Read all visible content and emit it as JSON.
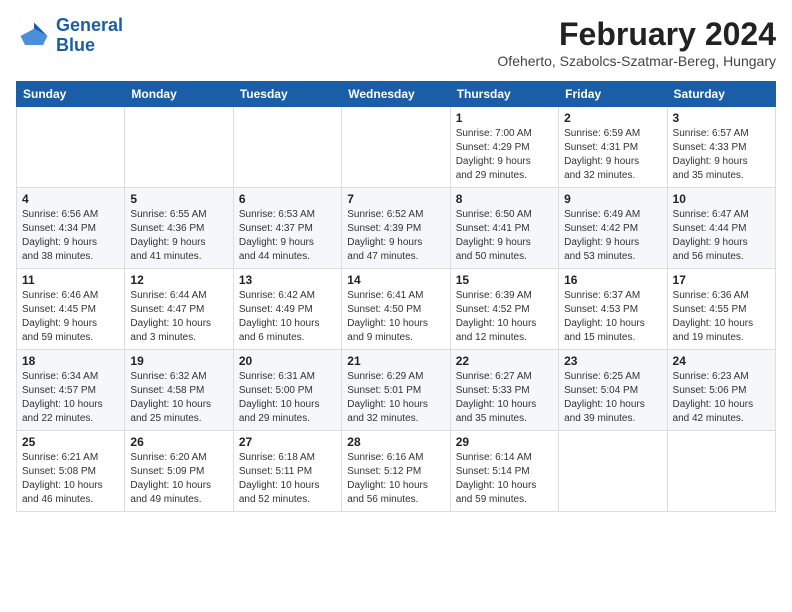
{
  "header": {
    "logo_line1": "General",
    "logo_line2": "Blue",
    "month_year": "February 2024",
    "location": "Ofeherto, Szabolcs-Szatmar-Bereg, Hungary"
  },
  "weekdays": [
    "Sunday",
    "Monday",
    "Tuesday",
    "Wednesday",
    "Thursday",
    "Friday",
    "Saturday"
  ],
  "weeks": [
    [
      {
        "day": "",
        "info": ""
      },
      {
        "day": "",
        "info": ""
      },
      {
        "day": "",
        "info": ""
      },
      {
        "day": "",
        "info": ""
      },
      {
        "day": "1",
        "info": "Sunrise: 7:00 AM\nSunset: 4:29 PM\nDaylight: 9 hours\nand 29 minutes."
      },
      {
        "day": "2",
        "info": "Sunrise: 6:59 AM\nSunset: 4:31 PM\nDaylight: 9 hours\nand 32 minutes."
      },
      {
        "day": "3",
        "info": "Sunrise: 6:57 AM\nSunset: 4:33 PM\nDaylight: 9 hours\nand 35 minutes."
      }
    ],
    [
      {
        "day": "4",
        "info": "Sunrise: 6:56 AM\nSunset: 4:34 PM\nDaylight: 9 hours\nand 38 minutes."
      },
      {
        "day": "5",
        "info": "Sunrise: 6:55 AM\nSunset: 4:36 PM\nDaylight: 9 hours\nand 41 minutes."
      },
      {
        "day": "6",
        "info": "Sunrise: 6:53 AM\nSunset: 4:37 PM\nDaylight: 9 hours\nand 44 minutes."
      },
      {
        "day": "7",
        "info": "Sunrise: 6:52 AM\nSunset: 4:39 PM\nDaylight: 9 hours\nand 47 minutes."
      },
      {
        "day": "8",
        "info": "Sunrise: 6:50 AM\nSunset: 4:41 PM\nDaylight: 9 hours\nand 50 minutes."
      },
      {
        "day": "9",
        "info": "Sunrise: 6:49 AM\nSunset: 4:42 PM\nDaylight: 9 hours\nand 53 minutes."
      },
      {
        "day": "10",
        "info": "Sunrise: 6:47 AM\nSunset: 4:44 PM\nDaylight: 9 hours\nand 56 minutes."
      }
    ],
    [
      {
        "day": "11",
        "info": "Sunrise: 6:46 AM\nSunset: 4:45 PM\nDaylight: 9 hours\nand 59 minutes."
      },
      {
        "day": "12",
        "info": "Sunrise: 6:44 AM\nSunset: 4:47 PM\nDaylight: 10 hours\nand 3 minutes."
      },
      {
        "day": "13",
        "info": "Sunrise: 6:42 AM\nSunset: 4:49 PM\nDaylight: 10 hours\nand 6 minutes."
      },
      {
        "day": "14",
        "info": "Sunrise: 6:41 AM\nSunset: 4:50 PM\nDaylight: 10 hours\nand 9 minutes."
      },
      {
        "day": "15",
        "info": "Sunrise: 6:39 AM\nSunset: 4:52 PM\nDaylight: 10 hours\nand 12 minutes."
      },
      {
        "day": "16",
        "info": "Sunrise: 6:37 AM\nSunset: 4:53 PM\nDaylight: 10 hours\nand 15 minutes."
      },
      {
        "day": "17",
        "info": "Sunrise: 6:36 AM\nSunset: 4:55 PM\nDaylight: 10 hours\nand 19 minutes."
      }
    ],
    [
      {
        "day": "18",
        "info": "Sunrise: 6:34 AM\nSunset: 4:57 PM\nDaylight: 10 hours\nand 22 minutes."
      },
      {
        "day": "19",
        "info": "Sunrise: 6:32 AM\nSunset: 4:58 PM\nDaylight: 10 hours\nand 25 minutes."
      },
      {
        "day": "20",
        "info": "Sunrise: 6:31 AM\nSunset: 5:00 PM\nDaylight: 10 hours\nand 29 minutes."
      },
      {
        "day": "21",
        "info": "Sunrise: 6:29 AM\nSunset: 5:01 PM\nDaylight: 10 hours\nand 32 minutes."
      },
      {
        "day": "22",
        "info": "Sunrise: 6:27 AM\nSunset: 5:33 PM\nDaylight: 10 hours\nand 35 minutes."
      },
      {
        "day": "23",
        "info": "Sunrise: 6:25 AM\nSunset: 5:04 PM\nDaylight: 10 hours\nand 39 minutes."
      },
      {
        "day": "24",
        "info": "Sunrise: 6:23 AM\nSunset: 5:06 PM\nDaylight: 10 hours\nand 42 minutes."
      }
    ],
    [
      {
        "day": "25",
        "info": "Sunrise: 6:21 AM\nSunset: 5:08 PM\nDaylight: 10 hours\nand 46 minutes."
      },
      {
        "day": "26",
        "info": "Sunrise: 6:20 AM\nSunset: 5:09 PM\nDaylight: 10 hours\nand 49 minutes."
      },
      {
        "day": "27",
        "info": "Sunrise: 6:18 AM\nSunset: 5:11 PM\nDaylight: 10 hours\nand 52 minutes."
      },
      {
        "day": "28",
        "info": "Sunrise: 6:16 AM\nSunset: 5:12 PM\nDaylight: 10 hours\nand 56 minutes."
      },
      {
        "day": "29",
        "info": "Sunrise: 6:14 AM\nSunset: 5:14 PM\nDaylight: 10 hours\nand 59 minutes."
      },
      {
        "day": "",
        "info": ""
      },
      {
        "day": "",
        "info": ""
      }
    ]
  ]
}
